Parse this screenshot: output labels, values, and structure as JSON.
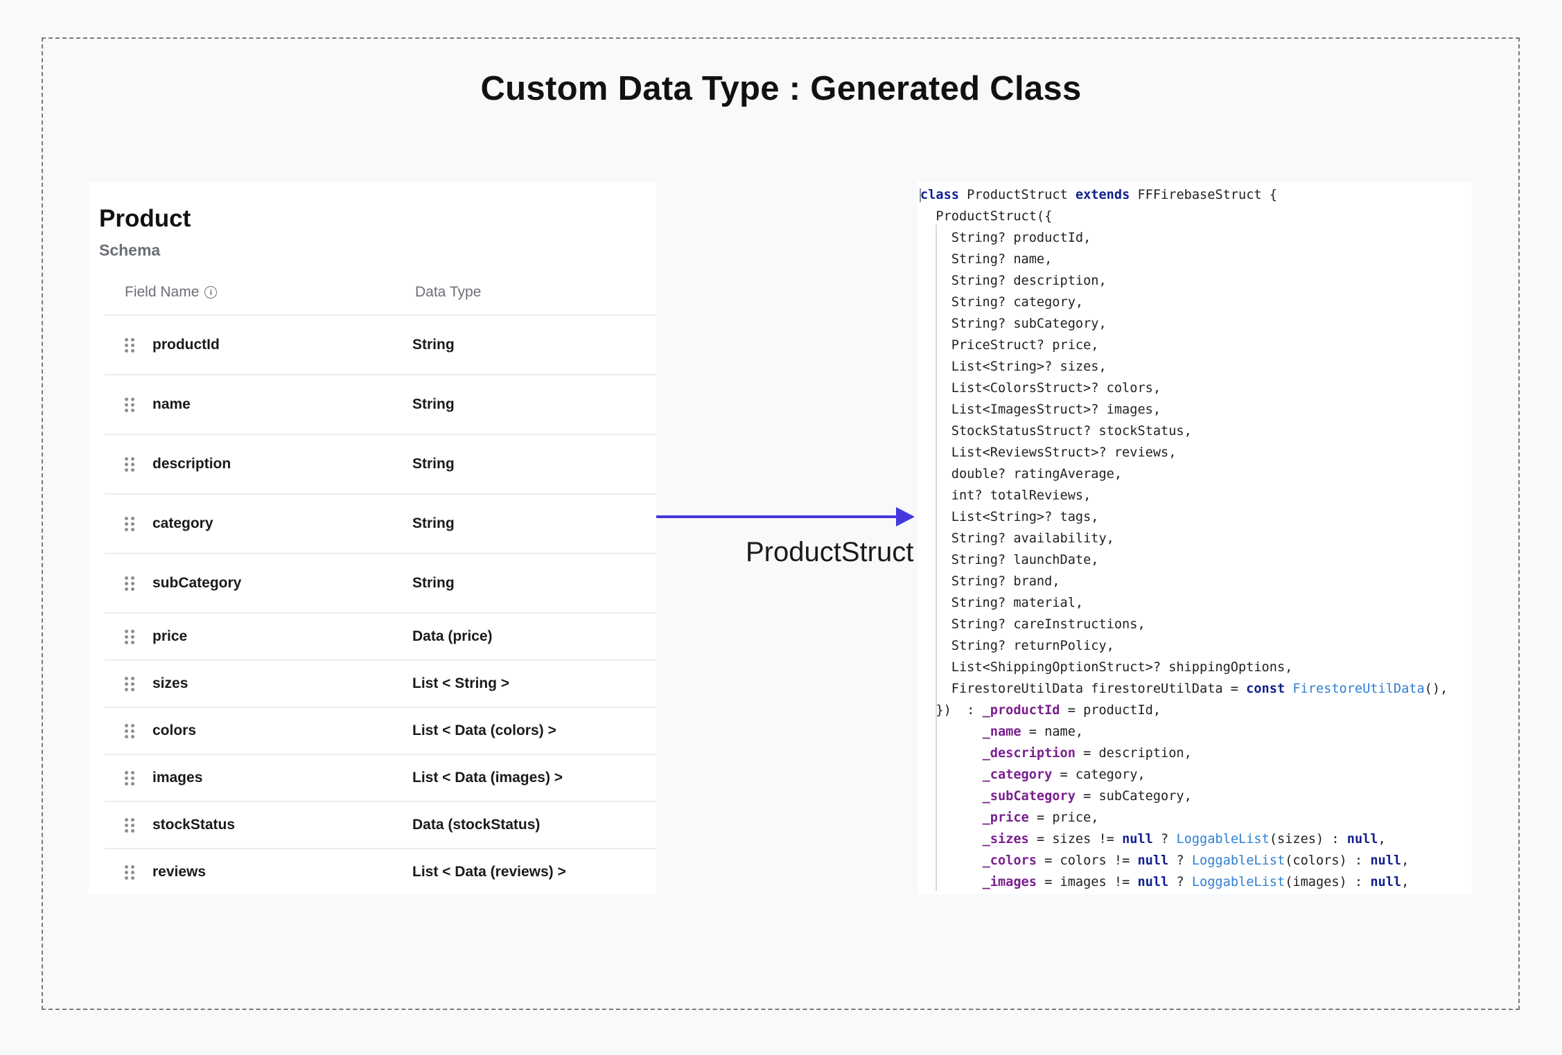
{
  "title": "Custom Data Type : Generated Class",
  "schema": {
    "title": "Product",
    "subtitle": "Schema",
    "col_field": "Field Name",
    "col_type": "Data Type",
    "rows": [
      {
        "name": "productId",
        "type": "String"
      },
      {
        "name": "name",
        "type": "String"
      },
      {
        "name": "description",
        "type": "String"
      },
      {
        "name": "category",
        "type": "String"
      },
      {
        "name": "subCategory",
        "type": "String"
      },
      {
        "name": "price",
        "type": "Data (price)"
      },
      {
        "name": "sizes",
        "type": "List < String >"
      },
      {
        "name": "colors",
        "type": "List < Data (colors) >"
      },
      {
        "name": "images",
        "type": "List < Data (images) >"
      },
      {
        "name": "stockStatus",
        "type": "Data (stockStatus)"
      },
      {
        "name": "reviews",
        "type": "List < Data (reviews) >"
      }
    ]
  },
  "arrow_label": "ProductStruct",
  "code": [
    [
      [
        "kw",
        "class"
      ],
      [
        "t",
        " ProductStruct "
      ],
      [
        "kw",
        "extends"
      ],
      [
        "t",
        " FFFirebaseStruct {"
      ]
    ],
    [
      [
        "t",
        "  ProductStruct({"
      ]
    ],
    [
      [
        "t",
        "    String? productId,"
      ]
    ],
    [
      [
        "t",
        "    String? name,"
      ]
    ],
    [
      [
        "t",
        "    String? description,"
      ]
    ],
    [
      [
        "t",
        "    String? category,"
      ]
    ],
    [
      [
        "t",
        "    String? subCategory,"
      ]
    ],
    [
      [
        "t",
        "    PriceStruct? price,"
      ]
    ],
    [
      [
        "t",
        "    List<String>? sizes,"
      ]
    ],
    [
      [
        "t",
        "    List<ColorsStruct>? colors,"
      ]
    ],
    [
      [
        "t",
        "    List<ImagesStruct>? images,"
      ]
    ],
    [
      [
        "t",
        "    StockStatusStruct? stockStatus,"
      ]
    ],
    [
      [
        "t",
        "    List<ReviewsStruct>? reviews,"
      ]
    ],
    [
      [
        "t",
        "    double? ratingAverage,"
      ]
    ],
    [
      [
        "t",
        "    int? totalReviews,"
      ]
    ],
    [
      [
        "t",
        "    List<String>? tags,"
      ]
    ],
    [
      [
        "t",
        "    String? availability,"
      ]
    ],
    [
      [
        "t",
        "    String? launchDate,"
      ]
    ],
    [
      [
        "t",
        "    String? brand,"
      ]
    ],
    [
      [
        "t",
        "    String? material,"
      ]
    ],
    [
      [
        "t",
        "    String? careInstructions,"
      ]
    ],
    [
      [
        "t",
        "    String? returnPolicy,"
      ]
    ],
    [
      [
        "t",
        "    List<ShippingOptionStruct>? shippingOptions,"
      ]
    ],
    [
      [
        "t",
        "    FirestoreUtilData firestoreUtilData = "
      ],
      [
        "kw",
        "const"
      ],
      [
        "t",
        " "
      ],
      [
        "fn",
        "FirestoreUtilData"
      ],
      [
        "t",
        "(),"
      ]
    ],
    [
      [
        "t",
        "  })  : "
      ],
      [
        "fld",
        "_productId"
      ],
      [
        "t",
        " = productId,"
      ]
    ],
    [
      [
        "t",
        "        "
      ],
      [
        "fld",
        "_name"
      ],
      [
        "t",
        " = name,"
      ]
    ],
    [
      [
        "t",
        "        "
      ],
      [
        "fld",
        "_description"
      ],
      [
        "t",
        " = description,"
      ]
    ],
    [
      [
        "t",
        "        "
      ],
      [
        "fld",
        "_category"
      ],
      [
        "t",
        " = category,"
      ]
    ],
    [
      [
        "t",
        "        "
      ],
      [
        "fld",
        "_subCategory"
      ],
      [
        "t",
        " = subCategory,"
      ]
    ],
    [
      [
        "t",
        "        "
      ],
      [
        "fld",
        "_price"
      ],
      [
        "t",
        " = price,"
      ]
    ],
    [
      [
        "t",
        "        "
      ],
      [
        "fld",
        "_sizes"
      ],
      [
        "t",
        " = sizes != "
      ],
      [
        "kw",
        "null"
      ],
      [
        "t",
        " ? "
      ],
      [
        "fn",
        "LoggableList"
      ],
      [
        "t",
        "(sizes) : "
      ],
      [
        "kw",
        "null"
      ],
      [
        "t",
        ","
      ]
    ],
    [
      [
        "t",
        "        "
      ],
      [
        "fld",
        "_colors"
      ],
      [
        "t",
        " = colors != "
      ],
      [
        "kw",
        "null"
      ],
      [
        "t",
        " ? "
      ],
      [
        "fn",
        "LoggableList"
      ],
      [
        "t",
        "(colors) : "
      ],
      [
        "kw",
        "null"
      ],
      [
        "t",
        ","
      ]
    ],
    [
      [
        "t",
        "        "
      ],
      [
        "fld",
        "_images"
      ],
      [
        "t",
        " = images != "
      ],
      [
        "kw",
        "null"
      ],
      [
        "t",
        " ? "
      ],
      [
        "fn",
        "LoggableList"
      ],
      [
        "t",
        "(images) : "
      ],
      [
        "kw",
        "null"
      ],
      [
        "t",
        ","
      ]
    ]
  ],
  "colors": {
    "arrow": "#4338e0",
    "keyword": "#0f1f8f",
    "field": "#7a1f8f",
    "function": "#2f7fd1"
  }
}
